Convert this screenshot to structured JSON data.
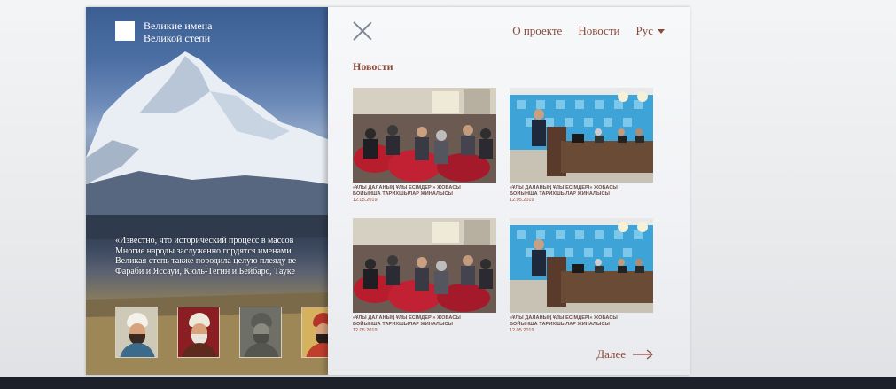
{
  "logo": {
    "line1": "Великие имена",
    "line2": "Великой степи"
  },
  "quote": {
    "line1": "«Известно, что исторический процесс в массов",
    "line2": "Многие народы заслуженно гордятся именами",
    "line3": "Великая степь также породила целую плеяду ве",
    "line4": "Фараби и Яссауи, Кюль-Тегин и Бейбарс, Тауке"
  },
  "nav": {
    "about": "О проекте",
    "news": "Новости",
    "lang": "Рус"
  },
  "section_title": "Новости",
  "news": [
    {
      "caption1": "«ҰЛЫ ДАЛАНЫҢ ҰЛЫ ЕСІМДЕРІ» ЖОБАСЫ",
      "caption2": "БОЙЫНША ТАРИХШЫЛАР ЖИНАЛЫСЫ",
      "date": "12.05.2019",
      "photo": "auditorium"
    },
    {
      "caption1": "«ҰЛЫ ДАЛАНЫҢ ҰЛЫ ЕСІМДЕРІ» ЖОБАСЫ",
      "caption2": "БОЙЫНША ТАРИХШЫЛАР ЖИНАЛЫСЫ",
      "date": "12.05.2019",
      "photo": "podium"
    },
    {
      "caption1": "«ҰЛЫ ДАЛАНЫҢ ҰЛЫ ЕСІМДЕРІ» ЖОБАСЫ",
      "caption2": "БОЙЫНША ТАРИХШЫЛАР ЖИНАЛЫСЫ",
      "date": "12.05.2019",
      "photo": "auditorium"
    },
    {
      "caption1": "«ҰЛЫ ДАЛАНЫҢ ҰЛЫ ЕСІМДЕРІ» ЖОБАСЫ",
      "caption2": "БОЙЫНША ТАРИХШЫЛАР ЖИНАЛЫСЫ",
      "date": "12.05.2019",
      "photo": "podium"
    }
  ],
  "more_label": "Далее",
  "icons": {
    "close": "close-icon",
    "lang_caret": "chevron-down-icon",
    "more_arrow": "arrow-right-icon"
  },
  "colors": {
    "accent": "#8c4a3a",
    "panel_bg": "#f1f2f5",
    "bottom_bar": "#1d2129"
  }
}
